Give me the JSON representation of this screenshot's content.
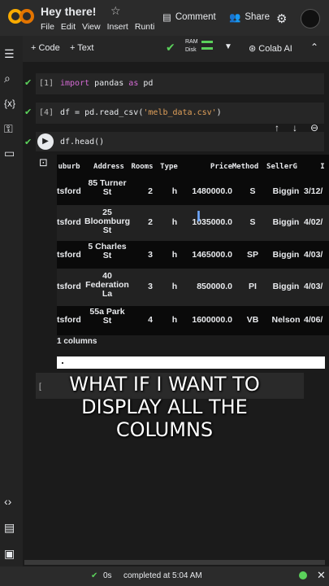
{
  "app": {
    "notebook_title": "Hey there!"
  },
  "menu": [
    "File",
    "Edit",
    "View",
    "Insert",
    "Runti"
  ],
  "header": {
    "comment_label": "Comment",
    "share_label": "Share"
  },
  "toolbar": {
    "code_label": "+ Code",
    "text_label": "+ Text",
    "ram_label": "RAM",
    "disk_label": "Disk",
    "colab_ai_label": "Colab AI"
  },
  "cells": [
    {
      "number": "[1]",
      "code": "import pandas as pd"
    },
    {
      "number": "[4]",
      "code": "df = pd.read_csv('melb_data.csv')"
    },
    {
      "number": "",
      "code": "df.head()"
    }
  ],
  "dataframe": {
    "headers": [
      "uburb",
      "Address",
      "Rooms",
      "Type",
      "Price",
      "Method",
      "SellerG",
      "I"
    ],
    "rows": [
      [
        "tsford",
        "85 Turner St",
        "2",
        "h",
        "1480000.0",
        "S",
        "Biggin",
        "3/12/"
      ],
      [
        "tsford",
        "25 Bloomburg St",
        "2",
        "h",
        "1035000.0",
        "S",
        "Biggin",
        "4/02/"
      ],
      [
        "tsford",
        "5 Charles St",
        "3",
        "h",
        "1465000.0",
        "SP",
        "Biggin",
        "4/03/"
      ],
      [
        "tsford",
        "40 Federation La",
        "3",
        "h",
        "850000.0",
        "PI",
        "Biggin",
        "4/03/"
      ],
      [
        "tsford",
        "55a Park St",
        "4",
        "h",
        "1600000.0",
        "VB",
        "Nelson",
        "4/06/"
      ]
    ],
    "columns_info": "1 columns"
  },
  "next_cell_bracket": "[",
  "caption": "WHAT IF I WANT TO DISPLAY ALL THE COLUMNS",
  "status": {
    "elapsed": "0s",
    "completed_text": "completed at 5:04 AM"
  },
  "colors": {
    "accent_green": "#5bd15b",
    "logo_orange": "#f9ab00",
    "keyword": "#d66bd6",
    "string": "#e0a05a"
  }
}
